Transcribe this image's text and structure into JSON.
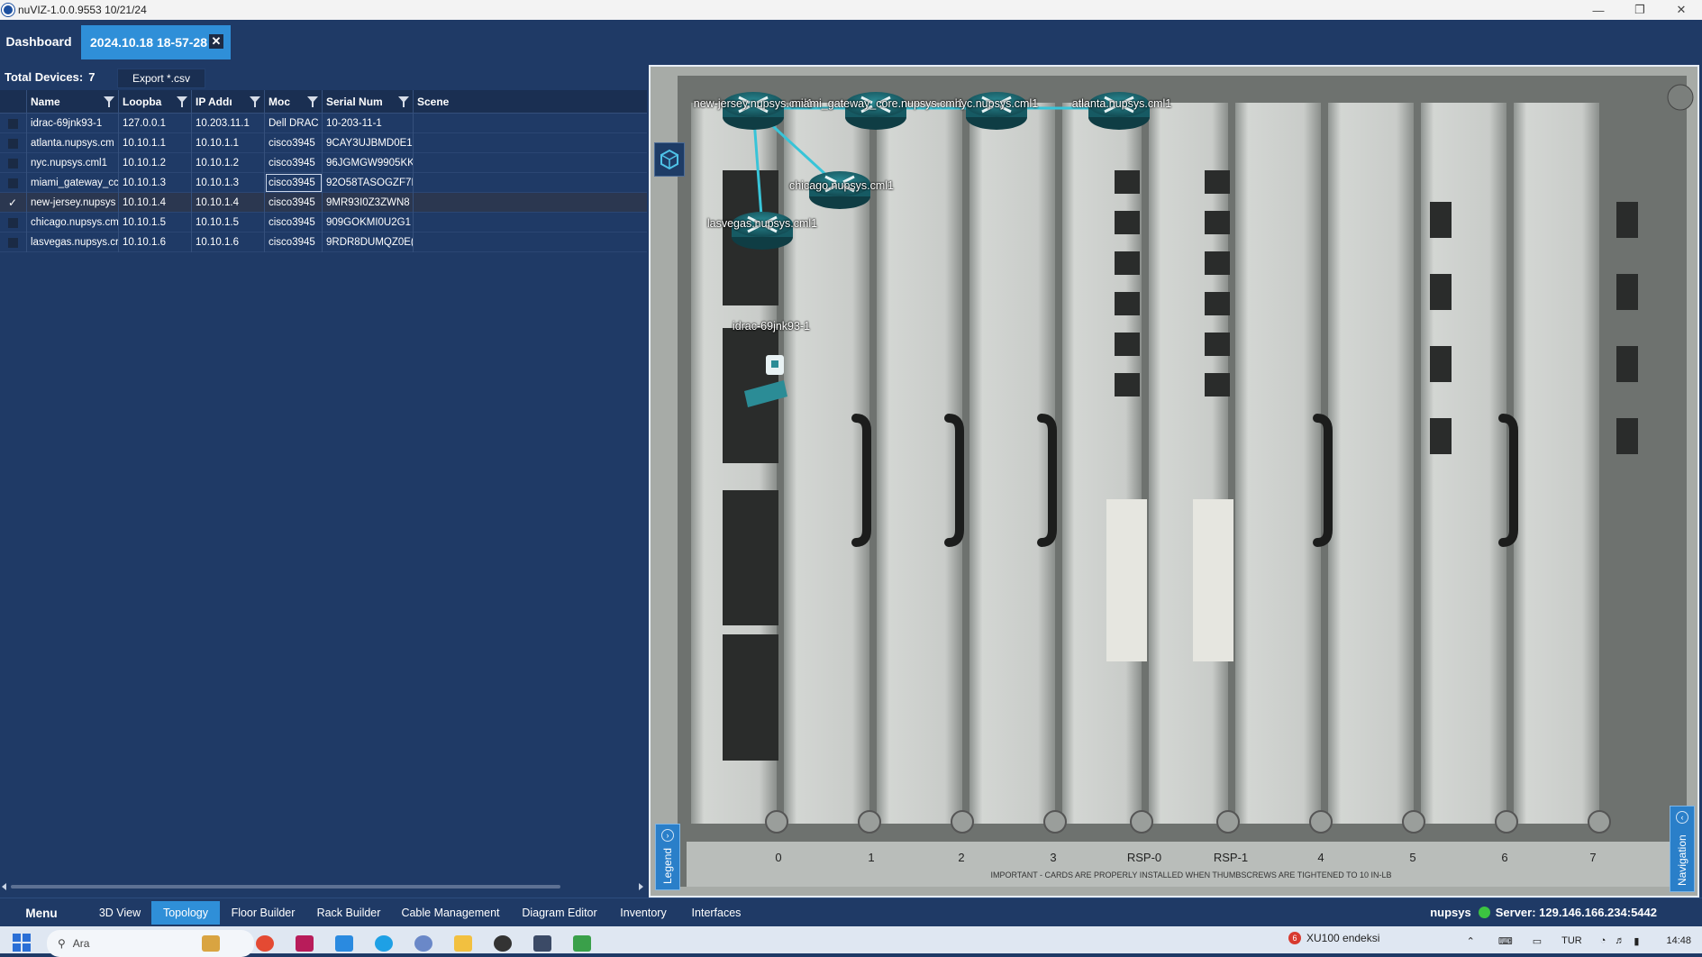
{
  "window": {
    "title": "nuVIZ-1.0.0.9553 10/21/24"
  },
  "tabs": {
    "dashboard": "Dashboard",
    "session": "2024.10.18 18-57-28"
  },
  "summary": {
    "label": "Total Devices:",
    "count": "7",
    "export": "Export *.csv"
  },
  "table": {
    "headers": [
      "Name",
      "Loopba",
      "IP Addı",
      "Moc",
      "Serial Num",
      "Scene"
    ],
    "rows": [
      {
        "checked": false,
        "name": "idrac-69jnk93-1",
        "loopback": "127.0.0.1",
        "ip": "10.203.11.1",
        "model": "Dell DRAC",
        "serial": "10-203-11-1",
        "scene": ""
      },
      {
        "checked": false,
        "name": "atlanta.nupsys.cm",
        "loopback": "10.10.1.1",
        "ip": "10.10.1.1",
        "model": "cisco3945",
        "serial": "9CAY3UJBMD0E1(",
        "scene": ""
      },
      {
        "checked": false,
        "name": "nyc.nupsys.cml1",
        "loopback": "10.10.1.2",
        "ip": "10.10.1.2",
        "model": "cisco3945",
        "serial": "96JGMGW9905KK",
        "scene": ""
      },
      {
        "checked": false,
        "name": "miami_gateway_cc",
        "loopback": "10.10.1.3",
        "ip": "10.10.1.3",
        "model": "cisco3945",
        "serial": "92O58TASOGZF7I",
        "scene": ""
      },
      {
        "checked": true,
        "name": "new-jersey.nupsys",
        "loopback": "10.10.1.4",
        "ip": "10.10.1.4",
        "model": "cisco3945",
        "serial": "9MR93I0Z3ZWN8",
        "scene": ""
      },
      {
        "checked": false,
        "name": "chicago.nupsys.cm",
        "loopback": "10.10.1.5",
        "ip": "10.10.1.5",
        "model": "cisco3945",
        "serial": "909GOKMI0U2G1",
        "scene": ""
      },
      {
        "checked": false,
        "name": "lasvegas.nupsys.cr",
        "loopback": "10.10.1.6",
        "ip": "10.10.1.6",
        "model": "cisco3945",
        "serial": "9RDR8DUMQZ0E(",
        "scene": ""
      }
    ]
  },
  "topology": {
    "nodes": {
      "new_jersey": "new-jersey.nupsys.cml1",
      "miami": "miami_gateway_core.nupsys.cml1",
      "nyc": "nyc.nupsys.cml1",
      "atlanta": "atlanta.nupsys.cml1",
      "chicago": "chicago.nupsys.cml1",
      "lasvegas": "lasvegas.nupsys.cml1",
      "idrac": "idrac-69jnk93-1"
    },
    "link_color": "#38c4d8",
    "router_color": "#1f6b74",
    "chassis_labels": [
      "0",
      "1",
      "2",
      "3",
      "RSP-0",
      "RSP-1",
      "4",
      "5",
      "6",
      "7"
    ],
    "chassis_notice": "IMPORTANT - CARDS ARE PROPERLY INSTALLED WHEN THUMBSCREWS ARE TIGHTENED TO 10 IN-LB",
    "legend": "Legend",
    "navigation": "Navigation"
  },
  "bottom_nav": {
    "menu": "Menu",
    "tabs": [
      "3D View",
      "Topology",
      "Floor Builder",
      "Rack Builder",
      "Cable Management",
      "Diagram Editor",
      "Inventory",
      "Interfaces"
    ],
    "active": "Topology"
  },
  "status": {
    "user": "nupsys",
    "server": "Server: 129.146.166.234:5442",
    "connected_color": "#3cc441"
  },
  "taskbar": {
    "search_placeholder": "Ara",
    "notification_count": "6",
    "notification_text": "XU100 endeksi",
    "language": "TUR",
    "time": "14:48"
  }
}
